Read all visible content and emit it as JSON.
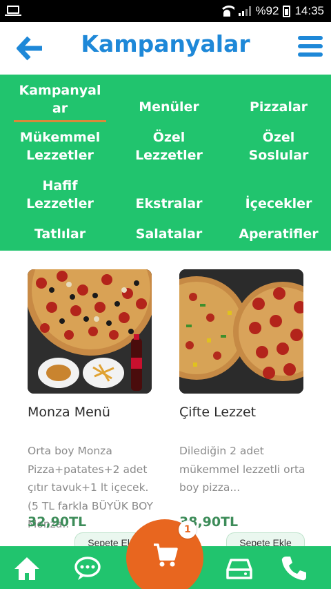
{
  "status_bar": {
    "battery": "%92",
    "time": "14:35"
  },
  "header": {
    "title": "Kampanyalar"
  },
  "categories": [
    {
      "label": "Kampanyal\nar",
      "active": true
    },
    {
      "label": "Menüler"
    },
    {
      "label": "Pizzalar"
    },
    {
      "label": "Mükemmel\nLezzetler"
    },
    {
      "label": "Özel\nLezzetler"
    },
    {
      "label": "Özel\nSoslular"
    },
    {
      "label": "Hafif\nLezzetler"
    },
    {
      "label": "Ekstralar"
    },
    {
      "label": "İçecekler"
    },
    {
      "label": "Tatlılar"
    },
    {
      "label": "Salatalar"
    },
    {
      "label": "Aperatifler"
    }
  ],
  "products": [
    {
      "name": "Monza Menü",
      "description": "Orta boy Monza Pizza+patates+2 adet çıtır tavuk+1 lt içecek.(5 TL farkla BÜYÜK BOY Monza..",
      "price": "32,90TL",
      "button": "Sepete Ekle"
    },
    {
      "name": "Çifte Lezzet",
      "description": "Dilediğin 2 adet mükemmel lezzetli orta boy pizza...",
      "price": "38,90TL",
      "button": "Sepete Ekle"
    }
  ],
  "cart": {
    "count": "1"
  },
  "colors": {
    "brand_blue": "#1e88d8",
    "brand_green": "#21c46e",
    "cart_orange": "#e8661f",
    "active_underline": "#d9893a"
  },
  "icons": {
    "back": "arrow-left-icon",
    "menu": "hamburger-menu-icon",
    "home": "home-icon",
    "chat": "chat-bubble-icon",
    "cart": "shopping-cart-icon",
    "orders": "drawer-icon",
    "phone": "phone-icon"
  }
}
